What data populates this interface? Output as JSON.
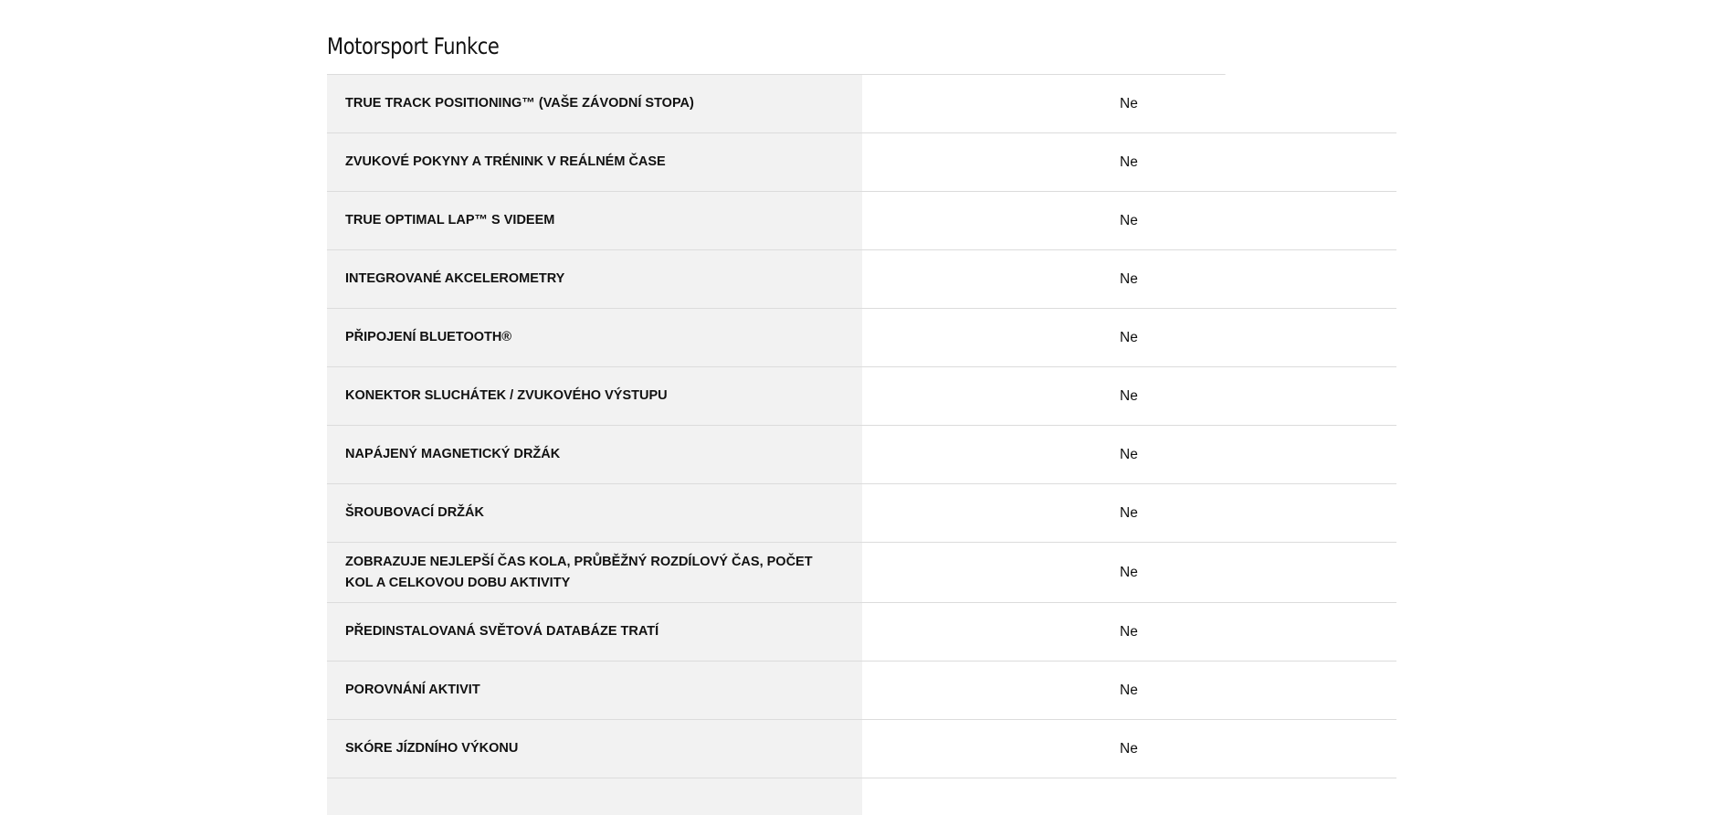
{
  "section": {
    "title": "Motorsport Funkce"
  },
  "rows": [
    {
      "label": "TRUE TRACK POSITIONING™ (VAŠE ZÁVODNÍ STOPA)",
      "value": "Ne"
    },
    {
      "label": "ZVUKOVÉ POKYNY A TRÉNINK V REÁLNÉM ČASE",
      "value": "Ne"
    },
    {
      "label": "TRUE OPTIMAL LAP™ S VIDEEM",
      "value": "Ne"
    },
    {
      "label": "INTEGROVANÉ AKCELEROMETRY",
      "value": "Ne"
    },
    {
      "label": "PŘIPOJENÍ BLUETOOTH®",
      "value": "Ne"
    },
    {
      "label": "KONEKTOR SLUCHÁTEK / ZVUKOVÉHO VÝSTUPU",
      "value": "Ne"
    },
    {
      "label": "NAPÁJENÝ MAGNETICKÝ DRŽÁK",
      "value": "Ne"
    },
    {
      "label": "ŠROUBOVACÍ DRŽÁK",
      "value": "Ne"
    },
    {
      "label": "ZOBRAZUJE NEJLEPŠÍ ČAS KOLA, PRŮBĚŽNÝ ROZDÍLOVÝ ČAS, POČET KOL A CELKOVOU DOBU AKTIVITY",
      "value": "Ne"
    },
    {
      "label": "PŘEDINSTALOVANÁ SVĚTOVÁ DATABÁZE TRATÍ",
      "value": "Ne"
    },
    {
      "label": "POROVNÁNÍ AKTIVIT",
      "value": "Ne"
    },
    {
      "label": "SKÓRE JÍZDNÍHO VÝKONU",
      "value": "Ne"
    }
  ]
}
